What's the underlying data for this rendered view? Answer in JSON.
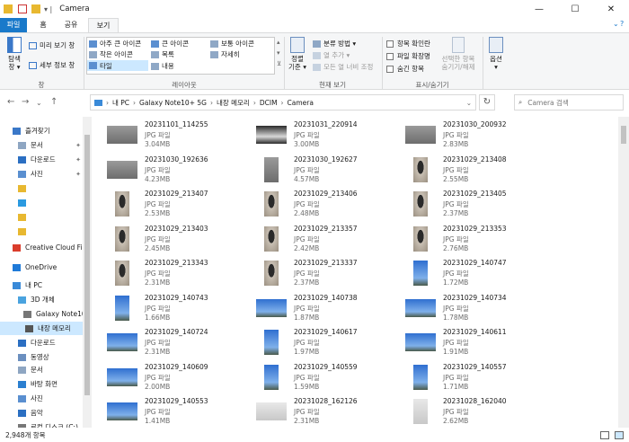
{
  "window": {
    "title": "Camera",
    "controls": [
      "—",
      "☐",
      "✕"
    ],
    "help": "?"
  },
  "ribbon_tabs": [
    "파일",
    "홈",
    "공유",
    "보기"
  ],
  "ribbon": {
    "panes": {
      "nav_pane": "탐색\n창 ▾",
      "preview": "미리 보기 창",
      "details": "세부 정보 창",
      "label": "창"
    },
    "layout": {
      "items": [
        "아주 큰 아이콘",
        "큰 아이콘",
        "보통 아이콘",
        "작은 아이콘",
        "목록",
        "자세히",
        "타일",
        "내용"
      ],
      "label": "레이아웃"
    },
    "current_view": {
      "sort": "정렬\n기준 ▾",
      "group": "분류 방법 ▾",
      "add_column": "열 추가 ▾",
      "fit_columns": "모든 열 너비 조정",
      "label": "현재 보기"
    },
    "show_hide": {
      "checkboxes": "항목 확인란",
      "extensions": "파일 확장명",
      "hidden": "숨긴 항목",
      "hide_selected": "선택한 항목\n숨기기/해제",
      "label": "표시/숨기기"
    },
    "options": {
      "label": "옵션\n▾"
    }
  },
  "address": {
    "crumbs": [
      "내 PC",
      "Galaxy Note10+ 5G",
      "내장 메모리",
      "DCIM",
      "Camera"
    ],
    "search_placeholder": "Camera 검색"
  },
  "sidebar": [
    {
      "label": "즐겨찾기",
      "icon": "star-icon",
      "color": "#3a78c8",
      "pinned": false
    },
    {
      "label": "문서",
      "icon": "documents-icon",
      "color": "#8ea6c2",
      "pinned": true
    },
    {
      "label": "다운로드",
      "icon": "download-icon",
      "color": "#2b6fc2",
      "pinned": true
    },
    {
      "label": "사진",
      "icon": "pictures-icon",
      "color": "#5a8fd0",
      "pinned": true
    },
    {
      "label": "",
      "icon": "folder-icon",
      "color": "#e8b830",
      "pinned": false
    },
    {
      "label": "",
      "icon": "folder-icon",
      "color": "#2b9ae0",
      "pinned": false
    },
    {
      "label": "",
      "icon": "folder-icon",
      "color": "#e8b830",
      "pinned": false
    },
    {
      "label": "",
      "icon": "folder-icon",
      "color": "#e8b830",
      "pinned": false
    },
    {
      "label": "Creative Cloud Fi",
      "icon": "creative-cloud-icon",
      "color": "#da3d2c",
      "pinned": false
    },
    {
      "label": "OneDrive",
      "icon": "onedrive-icon",
      "color": "#1f7ad8",
      "pinned": false
    },
    {
      "label": "내 PC",
      "icon": "pc-icon",
      "color": "#3a8ad8",
      "pinned": false
    },
    {
      "label": "3D 개체",
      "icon": "3d-objects-icon",
      "color": "#4aa3df",
      "pinned": false
    },
    {
      "label": "Galaxy Note10+",
      "icon": "phone-icon",
      "color": "#777777",
      "pinned": false
    },
    {
      "label": "내장 메모리",
      "icon": "storage-icon",
      "color": "#555555",
      "pinned": false,
      "selected": true
    },
    {
      "label": "다운로드",
      "icon": "download-icon",
      "color": "#2b6fc2",
      "pinned": false
    },
    {
      "label": "동영상",
      "icon": "videos-icon",
      "color": "#6b8fbf",
      "pinned": false
    },
    {
      "label": "문서",
      "icon": "documents-icon",
      "color": "#8ea6c2",
      "pinned": false
    },
    {
      "label": "바탕 화면",
      "icon": "desktop-icon",
      "color": "#2b7fd0",
      "pinned": false
    },
    {
      "label": "사진",
      "icon": "pictures-icon",
      "color": "#5a8fd0",
      "pinned": false
    },
    {
      "label": "음악",
      "icon": "music-icon",
      "color": "#2b6fc2",
      "pinned": false
    },
    {
      "label": "로컬 디스크 (C:)",
      "icon": "disk-icon",
      "color": "#777777",
      "pinned": false
    }
  ],
  "files": [
    {
      "name": "20231101_114255",
      "type": "JPG 파일",
      "size": "3.04MB",
      "thumb": "wide-gray"
    },
    {
      "name": "20231031_220914",
      "type": "JPG 파일",
      "size": "3.00MB",
      "thumb": "wide-dark"
    },
    {
      "name": "20231030_200932",
      "type": "JPG 파일",
      "size": "2.83MB",
      "thumb": "wide-gray"
    },
    {
      "name": "20231030_192636",
      "type": "JPG 파일",
      "size": "4.23MB",
      "thumb": "wide-gray"
    },
    {
      "name": "20231030_192627",
      "type": "JPG 파일",
      "size": "4.57MB",
      "thumb": "tall-gray"
    },
    {
      "name": "20231029_213408",
      "type": "JPG 파일",
      "size": "2.55MB",
      "thumb": "tall-person"
    },
    {
      "name": "20231029_213407",
      "type": "JPG 파일",
      "size": "2.53MB",
      "thumb": "tall-person"
    },
    {
      "name": "20231029_213406",
      "type": "JPG 파일",
      "size": "2.48MB",
      "thumb": "tall-person"
    },
    {
      "name": "20231029_213405",
      "type": "JPG 파일",
      "size": "2.37MB",
      "thumb": "tall-person"
    },
    {
      "name": "20231029_213403",
      "type": "JPG 파일",
      "size": "2.45MB",
      "thumb": "tall-person"
    },
    {
      "name": "20231029_213357",
      "type": "JPG 파일",
      "size": "2.42MB",
      "thumb": "tall-person"
    },
    {
      "name": "20231029_213353",
      "type": "JPG 파일",
      "size": "2.76MB",
      "thumb": "tall-person"
    },
    {
      "name": "20231029_213343",
      "type": "JPG 파일",
      "size": "2.31MB",
      "thumb": "tall-person"
    },
    {
      "name": "20231029_213337",
      "type": "JPG 파일",
      "size": "2.37MB",
      "thumb": "tall-person"
    },
    {
      "name": "20231029_140747",
      "type": "JPG 파일",
      "size": "1.72MB",
      "thumb": "tall-sky"
    },
    {
      "name": "20231029_140743",
      "type": "JPG 파일",
      "size": "1.66MB",
      "thumb": "tall-sky"
    },
    {
      "name": "20231029_140738",
      "type": "JPG 파일",
      "size": "1.87MB",
      "thumb": "wide-sky"
    },
    {
      "name": "20231029_140734",
      "type": "JPG 파일",
      "size": "1.78MB",
      "thumb": "wide-sky"
    },
    {
      "name": "20231029_140724",
      "type": "JPG 파일",
      "size": "2.31MB",
      "thumb": "wide-sky"
    },
    {
      "name": "20231029_140617",
      "type": "JPG 파일",
      "size": "1.97MB",
      "thumb": "tall-sky"
    },
    {
      "name": "20231029_140611",
      "type": "JPG 파일",
      "size": "1.91MB",
      "thumb": "wide-sky"
    },
    {
      "name": "20231029_140609",
      "type": "JPG 파일",
      "size": "2.00MB",
      "thumb": "wide-sky"
    },
    {
      "name": "20231029_140559",
      "type": "JPG 파일",
      "size": "1.59MB",
      "thumb": "tall-sky"
    },
    {
      "name": "20231029_140557",
      "type": "JPG 파일",
      "size": "1.71MB",
      "thumb": "tall-sky"
    },
    {
      "name": "20231029_140553",
      "type": "JPG 파일",
      "size": "1.41MB",
      "thumb": "wide-sky"
    },
    {
      "name": "20231028_162126",
      "type": "JPG 파일",
      "size": "2.31MB",
      "thumb": "wide-light"
    },
    {
      "name": "20231028_162040",
      "type": "JPG 파일",
      "size": "2.62MB",
      "thumb": "tall-light"
    }
  ],
  "status": {
    "count": "2,948개 항목"
  },
  "colors": {
    "accent": "#1979ca",
    "selection": "#cce8ff"
  }
}
